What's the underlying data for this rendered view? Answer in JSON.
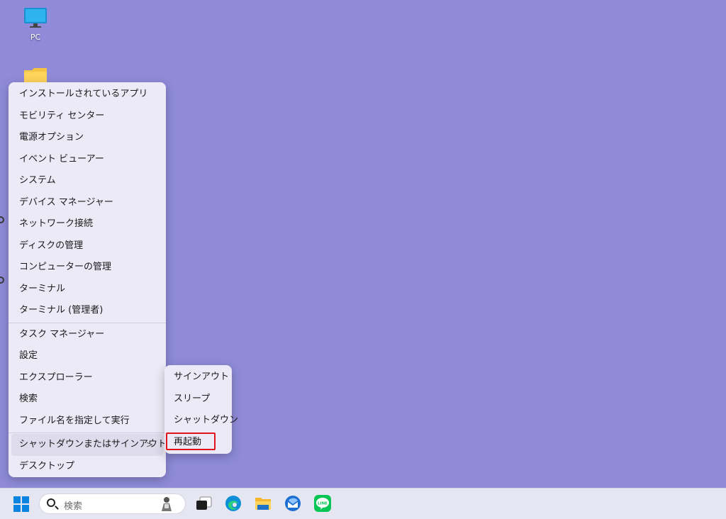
{
  "desktop": {
    "icons": [
      {
        "label": "PC",
        "icon": "monitor-icon"
      },
      {
        "label": "",
        "icon": "folder-icon"
      }
    ]
  },
  "context_menu": {
    "group1": [
      "インストールされているアプリ",
      "モビリティ センター",
      "電源オプション",
      "イベント ビューアー",
      "システム",
      "デバイス マネージャー",
      "ネットワーク接続",
      "ディスクの管理",
      "コンピューターの管理",
      "ターミナル",
      "ターミナル (管理者)"
    ],
    "group2": [
      "タスク マネージャー",
      "設定",
      "エクスプローラー",
      "検索",
      "ファイル名を指定して実行"
    ],
    "group3": [
      "シャットダウンまたはサインアウト",
      "デスクトップ"
    ],
    "submenu_chevron": ">"
  },
  "submenu": {
    "items": [
      "サインアウト",
      "スリープ",
      "シャットダウン",
      "再起動"
    ],
    "highlighted": "再起動"
  },
  "taskbar": {
    "search_placeholder": "検索",
    "apps": [
      "task-view-icon",
      "edge-icon",
      "file-explorer-icon",
      "thunderbird-icon",
      "line-icon"
    ]
  },
  "colors": {
    "desktop_bg": "#8f8bd9",
    "menu_bg": "#eceaf6",
    "highlight_border": "#e0141e",
    "start_blue": "#0a84e0",
    "line_green": "#06c755"
  }
}
